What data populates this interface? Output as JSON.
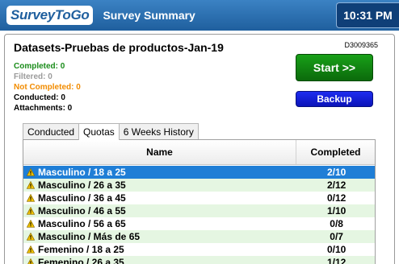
{
  "header": {
    "logo": "SurveyToGo",
    "title": "Survey Summary",
    "time": "10:31 PM"
  },
  "dataset": {
    "title": "Datasets-Pruebas de productos-Jan-19",
    "id": "D3009365"
  },
  "stats": {
    "completed": "Completed: 0",
    "filtered": "Filtered: 0",
    "not_completed": "Not Completed: 0",
    "conducted": "Conducted: 0",
    "attachments": "Attachments: 0"
  },
  "buttons": {
    "start": "Start >>",
    "backup": "Backup"
  },
  "tabs": [
    "Conducted",
    "Quotas",
    "6 Weeks History"
  ],
  "active_tab": "Quotas",
  "table": {
    "columns": [
      "Name",
      "Completed"
    ],
    "rows": [
      {
        "name": "Masculino / 18 a 25",
        "completed": "2/10",
        "selected": true
      },
      {
        "name": "Masculino / 26 a 35",
        "completed": "2/12"
      },
      {
        "name": "Masculino / 36 a 45",
        "completed": "0/12"
      },
      {
        "name": "Masculino / 46 a 55",
        "completed": "1/10"
      },
      {
        "name": "Masculino / 56 a 65",
        "completed": "0/8"
      },
      {
        "name": "Masculino / Más de 65",
        "completed": "0/7"
      },
      {
        "name": "Femenino / 18 a 25",
        "completed": "0/10"
      },
      {
        "name": "Femenino / 26 a 35",
        "completed": "1/12"
      }
    ]
  },
  "colors": {
    "titlebar": "#1f5f9e",
    "selected_row": "#1f7ed6",
    "alt_row": "#e5f6e2",
    "start_button": "#0b6a0b",
    "backup_button": "#0b14b8",
    "warning_icon": "#f2c200"
  },
  "icons": {
    "row_icon": "warning-icon"
  }
}
